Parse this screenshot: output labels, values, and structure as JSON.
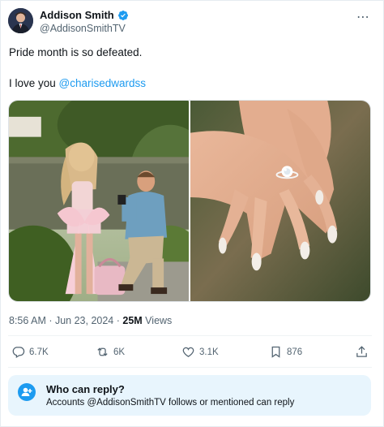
{
  "author": {
    "name": "Addison Smith",
    "handle": "@AddisonSmithTV",
    "verified": true
  },
  "tweet": {
    "line1": "Pride month is so defeated.",
    "line2_prefix": "I love you ",
    "mention": "@charisedwardss"
  },
  "media": {
    "images": [
      {
        "icon": "proposal-photo"
      },
      {
        "icon": "engagement-ring-photo"
      }
    ]
  },
  "meta": {
    "time": "8:56 AM · Jun 23, 2024 · ",
    "views_count": "25M",
    "views_label": " Views"
  },
  "actions": {
    "replies": "6.7K",
    "reposts": "6K",
    "likes": "3.1K",
    "bookmarks": "876"
  },
  "reply_settings": {
    "title": "Who can reply?",
    "subtitle": "Accounts @AddisonSmithTV follows or mentioned can reply"
  },
  "colors": {
    "accent": "#1d9bf0",
    "muted": "#536471",
    "text": "#0f1419",
    "reply_bg": "#e8f5fd"
  }
}
